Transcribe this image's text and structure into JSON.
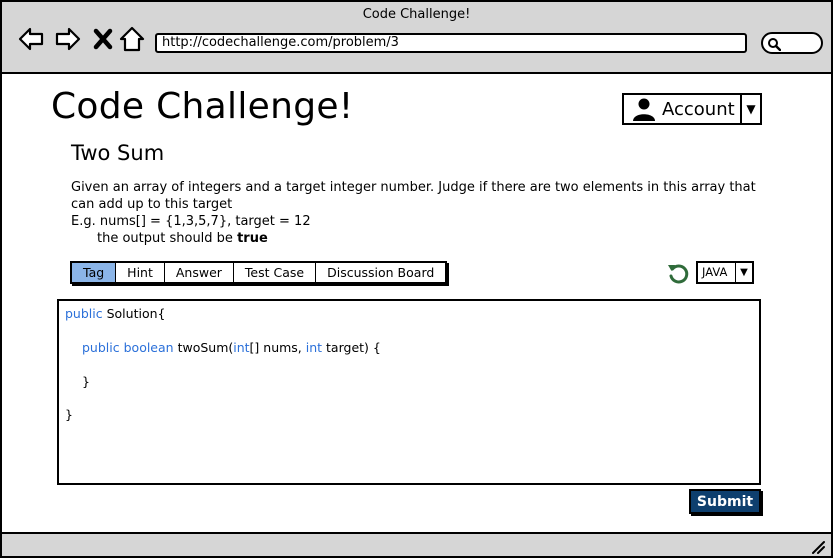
{
  "window": {
    "title": "Code Challenge!"
  },
  "browser": {
    "url": "http://codechallenge.com/problem/3",
    "icons": [
      "back-icon",
      "forward-icon",
      "close-icon",
      "home-icon",
      "search-icon"
    ]
  },
  "header": {
    "brand": "Code Challenge!",
    "account_label": "Account"
  },
  "problem": {
    "title": "Two Sum",
    "description": "Given an array of integers and a target integer number. Judge if there are two elements in this array that can add up to this target",
    "example_line": "E.g. nums[] = {1,3,5,7}, target = 12",
    "output_prefix": "the output should be ",
    "output_value": "true"
  },
  "tabs": [
    {
      "label": "Tag",
      "active": true
    },
    {
      "label": "Hint",
      "active": false
    },
    {
      "label": "Answer",
      "active": false
    },
    {
      "label": "Test Case",
      "active": false
    },
    {
      "label": "Discussion Board",
      "active": false
    }
  ],
  "language": {
    "selected": "JAVA"
  },
  "code": {
    "l1_kw": "public",
    "l1_rest": " Solution{",
    "l2_kw1": "public",
    "l2_kw2": "boolean",
    "l2_name": " twoSum(",
    "l2_kw3": "int",
    "l2_mid": "[] nums, ",
    "l2_kw4": "int",
    "l2_end": " target) {",
    "l3": "}",
    "l4": "}"
  },
  "actions": {
    "submit_label": "Submit"
  },
  "colors": {
    "chrome": "#d6d6d6",
    "active_tab": "#8bb5e8",
    "keyword": "#2b70d9",
    "submit_bg": "#0e3f6e",
    "refresh": "#2f6b3a"
  }
}
